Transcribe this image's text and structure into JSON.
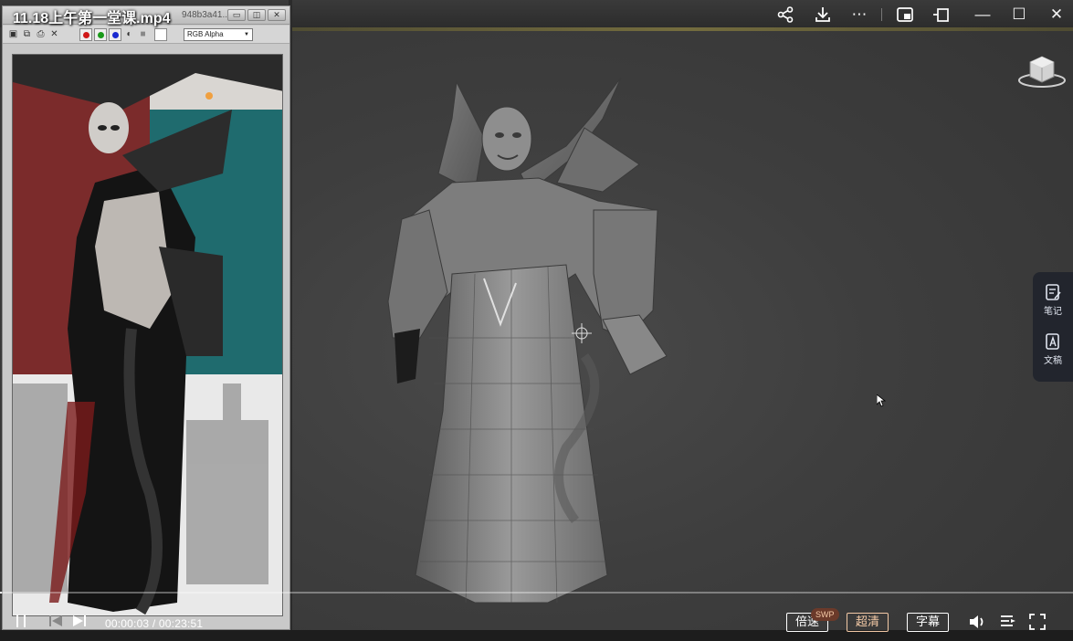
{
  "player": {
    "title": "11.18上午第一堂课.mp4",
    "current_time": "00:00:03",
    "duration": "00:23:51",
    "time_separator": " / ",
    "progress_fraction": 0.002,
    "speed_label": "倍速",
    "speed_badge": "SWP",
    "quality_label": "超清",
    "subtitle_label": "字幕",
    "top_icons": [
      "share-icon",
      "download-icon",
      "more-icon",
      "picture-in-picture-icon",
      "crop-icon",
      "minimize-icon",
      "maximize-icon",
      "close-icon"
    ],
    "control_icons": [
      "pause-icon",
      "previous-icon",
      "next-icon",
      "volume-icon",
      "playlist-icon",
      "fullscreen-icon"
    ]
  },
  "side_panel": {
    "items": [
      {
        "label": "笔记",
        "icon": "notes-icon"
      },
      {
        "label": "文稿",
        "icon": "document-icon"
      }
    ]
  },
  "reference_window": {
    "title": "948b3a41...",
    "channel_select": "RGB Alpha",
    "channel_buttons": [
      "red-channel",
      "green-channel",
      "blue-channel"
    ]
  },
  "colors": {
    "accent_quality": "#f3c9a6",
    "viewport_bg": "#3e3e3e",
    "swp_badge": "#6b3a2a"
  }
}
